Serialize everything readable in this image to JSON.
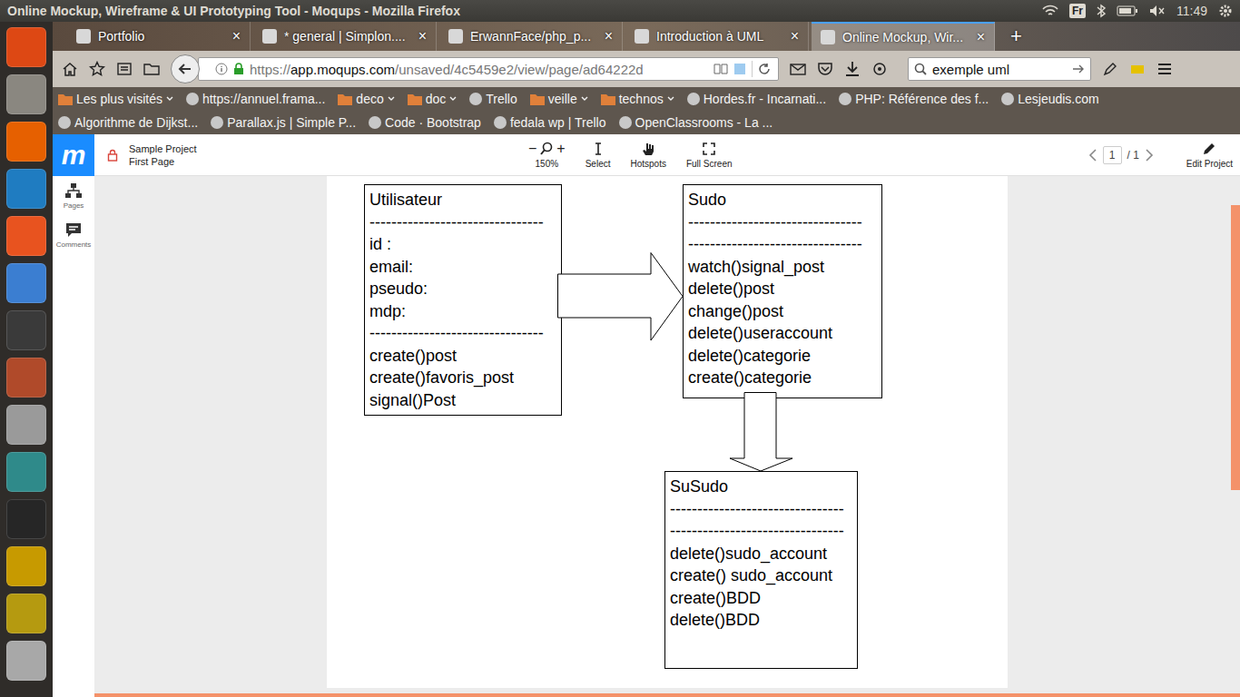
{
  "system_bar": {
    "title": "Online Mockup, Wireframe & UI Prototyping Tool - Moqups - Mozilla Firefox",
    "keyboard": "Fr",
    "time": "11:49"
  },
  "browser": {
    "tabs": [
      {
        "label": "Portfolio",
        "selected": false
      },
      {
        "label": "* general | Simplon....",
        "selected": false
      },
      {
        "label": "ErwannFace/php_p...",
        "selected": false
      },
      {
        "label": "Introduction à UML",
        "selected": false
      },
      {
        "label": "Online Mockup, Wir...",
        "selected": true
      }
    ],
    "tab_close": "×",
    "new_tab": "+",
    "url": {
      "scheme": "https://",
      "host": "app.moqups.com",
      "path": "/unsaved/4c5459e2/view/page/ad64222d"
    },
    "search": "exemple uml",
    "bookmarks": [
      [
        {
          "label": "Les plus visités",
          "kind": "folder"
        },
        {
          "label": "https://annuel.frama...",
          "kind": "site"
        },
        {
          "label": "deco",
          "kind": "folder"
        },
        {
          "label": "doc",
          "kind": "folder"
        },
        {
          "label": "Trello",
          "kind": "site"
        },
        {
          "label": "veille",
          "kind": "folder"
        },
        {
          "label": "technos",
          "kind": "folder"
        },
        {
          "label": "Hordes.fr - Incarnati...",
          "kind": "site"
        },
        {
          "label": "PHP: Référence des f...",
          "kind": "site"
        },
        {
          "label": "Lesjeudis.com",
          "kind": "site"
        }
      ],
      [
        {
          "label": "Algorithme de Dijkst...",
          "kind": "site"
        },
        {
          "label": "Parallax.js | Simple P...",
          "kind": "site"
        },
        {
          "label": "Code · Bootstrap",
          "kind": "site"
        },
        {
          "label": "fedala wp | Trello",
          "kind": "site"
        },
        {
          "label": "OpenClassrooms - La ...",
          "kind": "site"
        }
      ]
    ]
  },
  "app": {
    "logo": "m",
    "project": "Sample Project",
    "page": "First Page",
    "zoom_out": "−",
    "zoom_in": "+",
    "zoom": "150%",
    "tools": [
      {
        "label": "Select",
        "kind": "select"
      },
      {
        "label": "Hotspots",
        "kind": "hotspots"
      },
      {
        "label": "Full Screen",
        "kind": "fullscreen"
      }
    ],
    "pager": {
      "current": "1",
      "total": "/ 1"
    },
    "edit": "Edit Project",
    "sidebar": [
      {
        "label": "Pages",
        "kind": "pages"
      },
      {
        "label": "Comments",
        "kind": "comments"
      }
    ]
  },
  "diagram": {
    "classes": [
      {
        "name": "Utilisateur",
        "lines": [
          "--------------------------------",
          "id :",
          "email:",
          "pseudo:",
          "mdp:",
          "--------------------------------",
          "create()post",
          "create()favoris_post",
          "signal()Post"
        ]
      },
      {
        "name": "Sudo",
        "lines": [
          "--------------------------------",
          "--------------------------------",
          "watch()signal_post",
          "delete()post",
          "change()post",
          "delete()useraccount",
          "delete()categorie",
          "create()categorie"
        ]
      },
      {
        "name": "SuSudo",
        "lines": [
          "--------------------------------",
          "--------------------------------",
          "delete()sudo_account",
          "create() sudo_account",
          "create()BDD",
          "delete()BDD"
        ]
      }
    ]
  }
}
